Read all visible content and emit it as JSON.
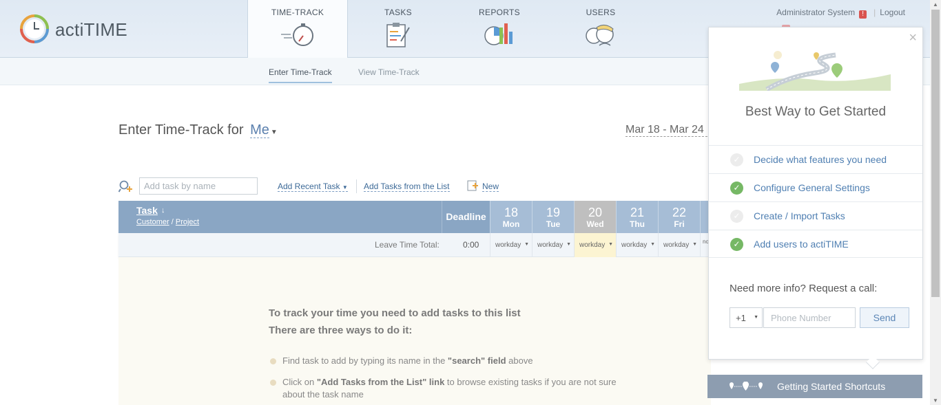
{
  "app": {
    "name": "actiTIME"
  },
  "nav": {
    "tabs": [
      {
        "label": "TIME-TRACK"
      },
      {
        "label": "TASKS"
      },
      {
        "label": "REPORTS"
      },
      {
        "label": "USERS"
      }
    ],
    "user": "Administrator System",
    "warn": "!",
    "logout": "Logout",
    "separator": "|"
  },
  "subnav": {
    "items": [
      {
        "label": "Enter Time-Track"
      },
      {
        "label": "View Time-Track"
      }
    ]
  },
  "page": {
    "title": "Enter Time-Track for",
    "user_select": "Me",
    "date_range": "Mar 18 - Mar 24"
  },
  "toolbar": {
    "search_placeholder": "Add task by name",
    "add_recent": "Add Recent Task",
    "add_from_list": "Add Tasks from the List",
    "new": "New"
  },
  "grid": {
    "task_header": "Task",
    "sort_icon": "↓",
    "customer_label": "Customer",
    "subheader_separator": "/",
    "project_label": "Project",
    "deadline_header": "Deadline",
    "days": [
      {
        "num": "18",
        "wd": "Mon"
      },
      {
        "num": "19",
        "wd": "Tue"
      },
      {
        "num": "20",
        "wd": "Wed"
      },
      {
        "num": "21",
        "wd": "Thu"
      },
      {
        "num": "22",
        "wd": "Fri"
      }
    ],
    "leave_time_label": "Leave Time Total:",
    "leave_time_total": "0:00",
    "day_types": [
      "workday",
      "workday",
      "workday",
      "workday",
      "workday"
    ],
    "next_day_type_truncated": "no"
  },
  "empty": {
    "h1": "To track your time you need to add tasks to this list",
    "h2": "There are three ways to do it:",
    "bullets": [
      {
        "pre": "Find task to add by typing its name in the ",
        "bold": "\"search\" field",
        "post": " above"
      },
      {
        "pre": "Click on ",
        "bold": "\"Add Tasks from the List\" link",
        "post": " to browse existing tasks if you are not sure about the task name"
      }
    ]
  },
  "popup": {
    "close": "×",
    "title": "Best Way to Get Started",
    "steps": [
      {
        "label": "Decide what features you need",
        "done": false
      },
      {
        "label": "Configure General Settings",
        "done": true
      },
      {
        "label": "Create / Import Tasks",
        "done": false
      },
      {
        "label": "Add users to actiTIME",
        "done": true
      }
    ],
    "check": "✓",
    "need_info": "Need more info? Request a call:",
    "country_code": "+1",
    "phone_placeholder": "Phone Number",
    "send": "Send"
  },
  "shortcuts": {
    "label": "Getting Started Shortcuts"
  },
  "colors": {
    "accent": "#8aa6c4",
    "link": "#3d6a98",
    "done": "#76b865"
  }
}
